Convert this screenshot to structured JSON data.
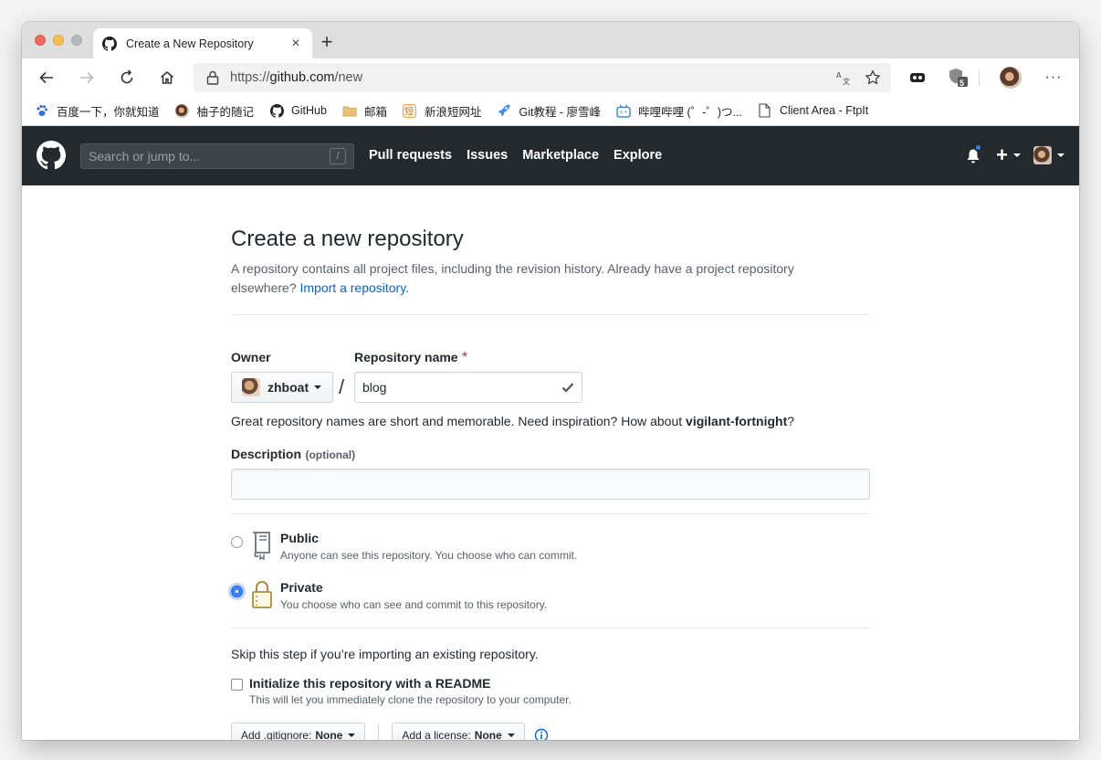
{
  "browser": {
    "tab_title": "Create a New Repository",
    "tab_close": "×",
    "new_tab": "+",
    "url_prefix": "https://",
    "url_host": "github.com",
    "url_path": "/new",
    "extension_badge": "5",
    "menu": "···"
  },
  "bookmarks": [
    {
      "label": "百度一下，你就知道",
      "icon": "paw-icon"
    },
    {
      "label": "柚子的随记",
      "icon": "avatar-icon"
    },
    {
      "label": "GitHub",
      "icon": "github-icon"
    },
    {
      "label": "邮箱",
      "icon": "folder-icon"
    },
    {
      "label": "新浪短网址",
      "icon": "short-url-icon"
    },
    {
      "label": "Git教程 - 廖雪峰",
      "icon": "rocket-icon"
    },
    {
      "label": "哔哩哔哩 (゜-゜)つ...",
      "icon": "tv-icon"
    },
    {
      "label": "Client Area - FtpIt",
      "icon": "page-icon"
    }
  ],
  "header": {
    "search_placeholder": "Search or jump to...",
    "search_key": "/",
    "nav": [
      "Pull requests",
      "Issues",
      "Marketplace",
      "Explore"
    ],
    "plus": "+"
  },
  "form": {
    "title": "Create a new repository",
    "subhead_text": "A repository contains all project files, including the revision history. Already have a project repository elsewhere?",
    "subhead_link": "Import a repository.",
    "owner_label": "Owner",
    "owner_value": "zhboat",
    "separator": "/",
    "repo_label": "Repository name",
    "required_mark": "*",
    "repo_value": "blog",
    "name_hint": "Great repository names are short and memorable. Need inspiration? How about",
    "name_suggestion": "vigilant-fortnight",
    "name_hint_end": "?",
    "description_label": "Description",
    "description_optional": "(optional)",
    "description_value": "",
    "public_title": "Public",
    "public_desc": "Anyone can see this repository. You choose who can commit.",
    "private_title": "Private",
    "private_desc": "You choose who can see and commit to this repository.",
    "selected_visibility": "Private",
    "skip_note": "Skip this step if you’re importing an existing repository.",
    "readme_label": "Initialize this repository with a README",
    "readme_desc": "This will let you immediately clone the repository to your computer.",
    "readme_checked": false,
    "gitignore_label": "Add .gitignore:",
    "gitignore_value": "None",
    "license_label": "Add a license:",
    "license_value": "None"
  },
  "colors": {
    "header_bg": "#24292e",
    "link": "#0366d6",
    "required": "#cb2431",
    "radio_selected": "#3b82f6"
  }
}
